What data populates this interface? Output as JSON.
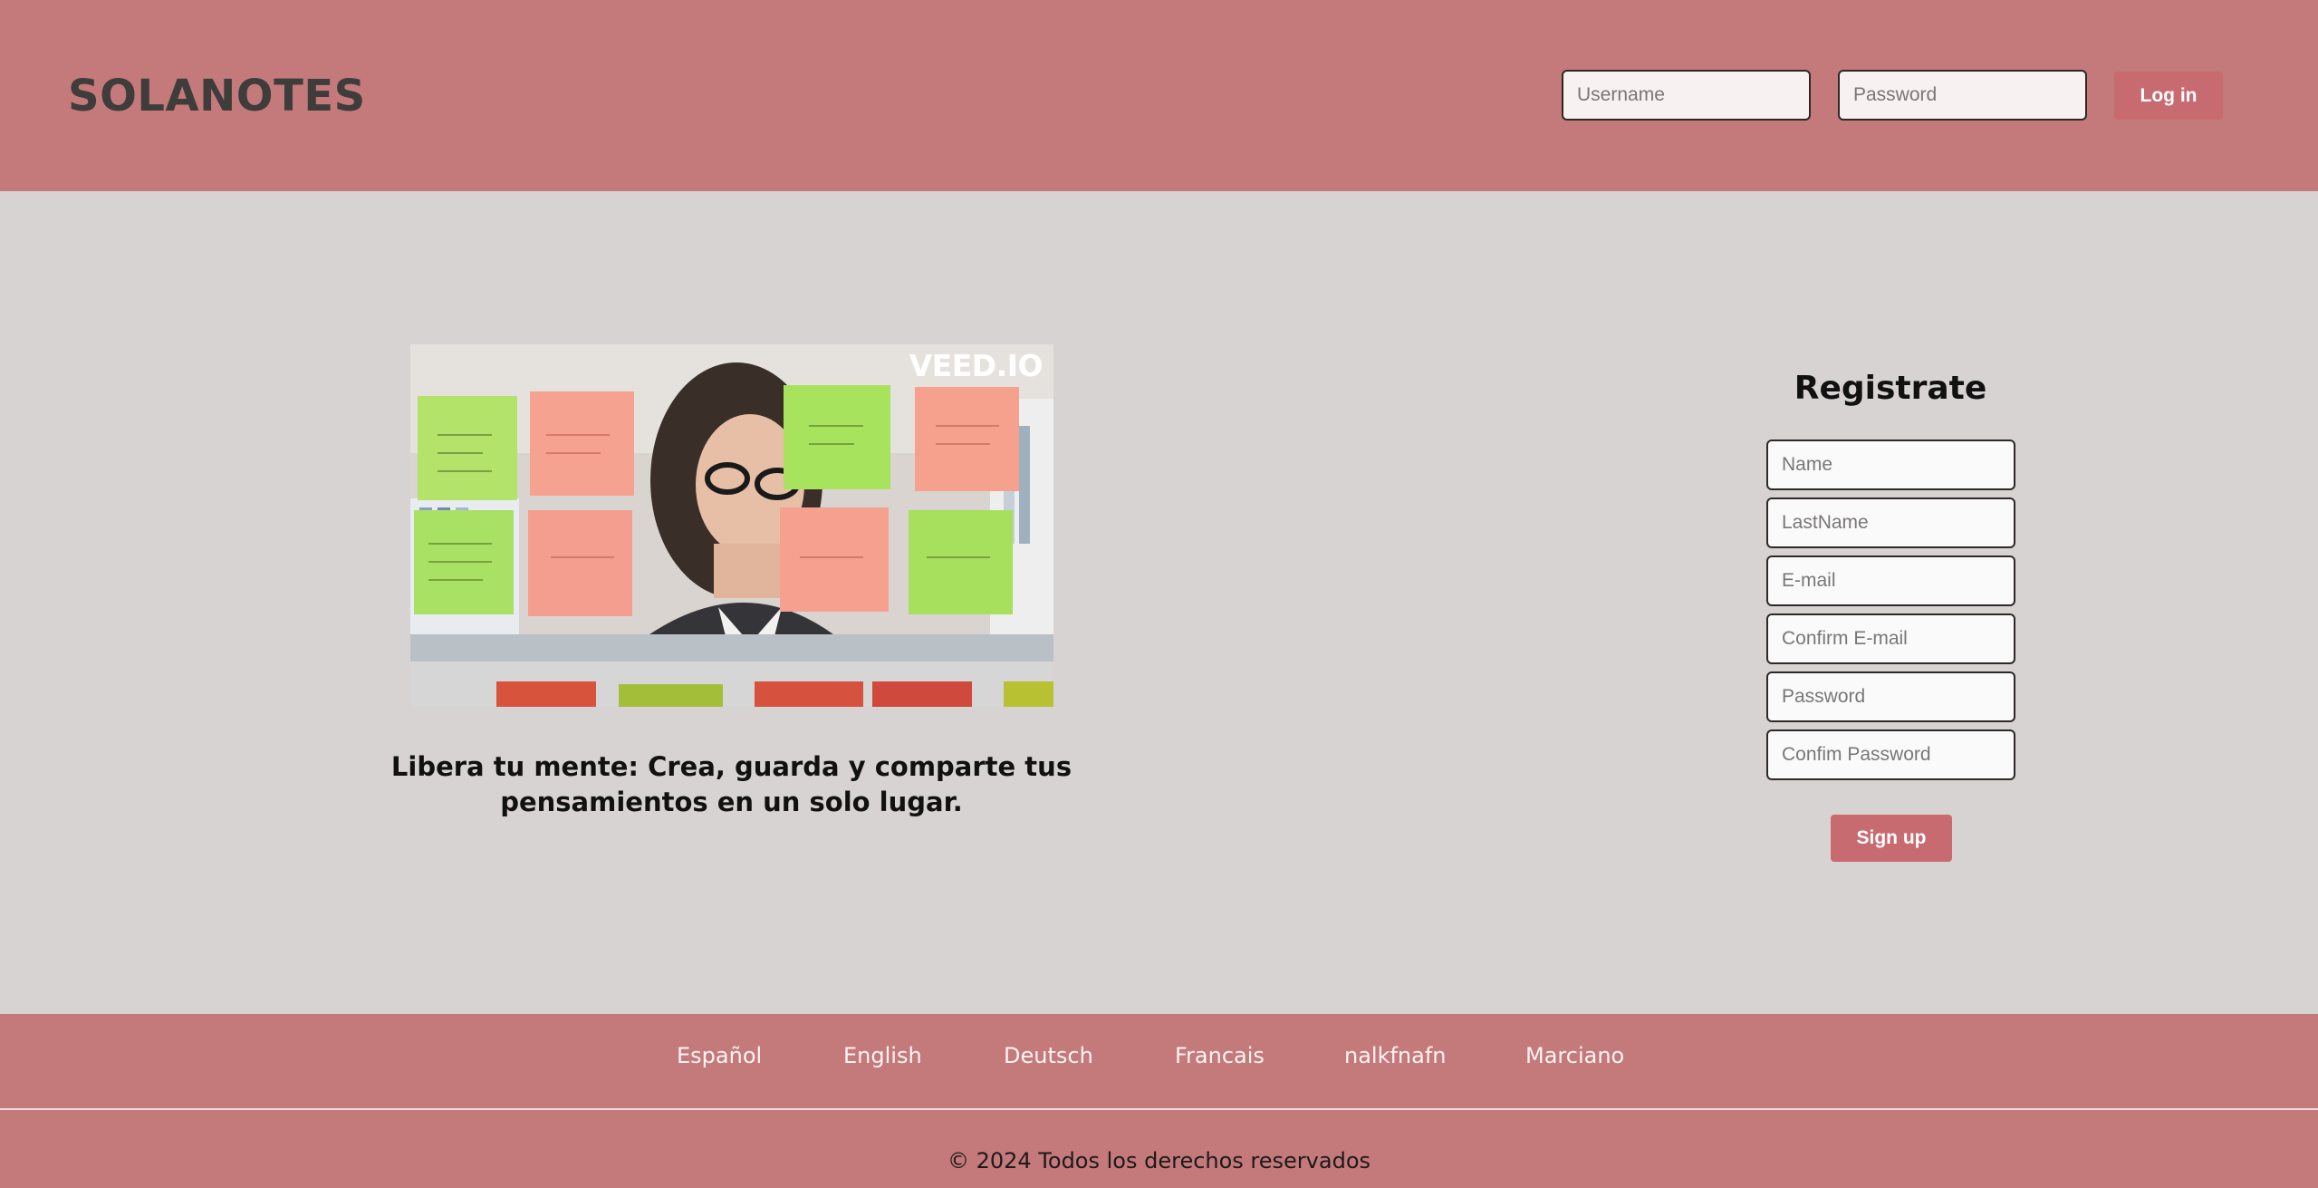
{
  "colors": {
    "accent": "#c4797a",
    "button": "#c86b70",
    "background": "#d8d3d3"
  },
  "header": {
    "brand": "SOLANOTES",
    "username_placeholder": "Username",
    "password_placeholder": "Password",
    "login_label": "Log in"
  },
  "main": {
    "video_watermark": "VEED.IO",
    "tagline": "Libera tu mente: Crea, guarda y comparte tus pensamientos en un solo lugar."
  },
  "register": {
    "title": "Registrate",
    "fields": {
      "name": "Name",
      "lastname": "LastName",
      "email": "E-mail",
      "confirm_email": "Confirm E-mail",
      "password": "Password",
      "confirm_password": "Confim Password"
    },
    "signup_label": "Sign up"
  },
  "footer": {
    "languages": [
      "Español",
      "English",
      "Deutsch",
      "Francais",
      "nalkfnafn",
      "Marciano"
    ],
    "copyright": "© 2024 Todos los derechos reservados"
  }
}
